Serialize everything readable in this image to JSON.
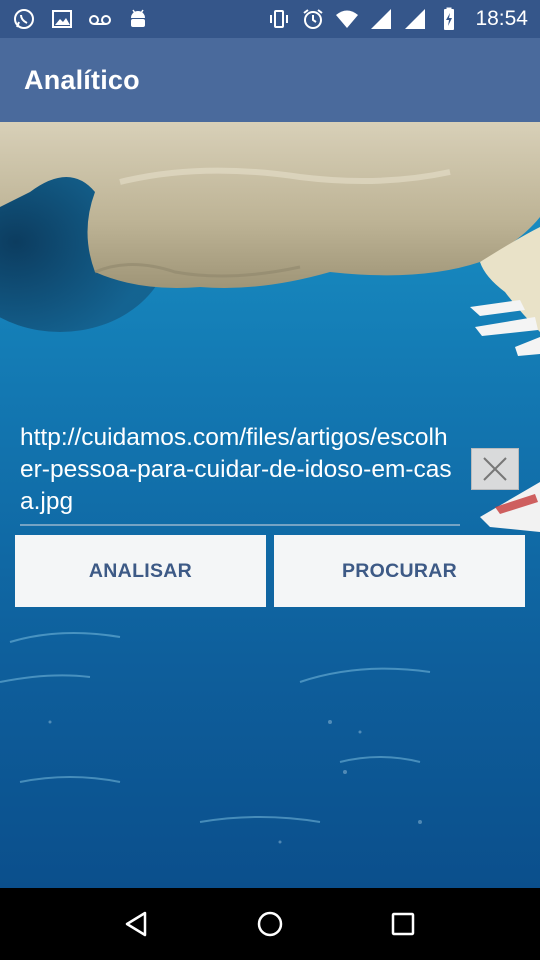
{
  "status_bar": {
    "time": "18:54",
    "icons_left": [
      "whatsapp-icon",
      "image-icon",
      "voicemail-icon",
      "android-icon"
    ],
    "icons_right": [
      "vibrate-icon",
      "alarm-icon",
      "wifi-icon",
      "signal-icon",
      "signal-icon",
      "battery-charging-icon"
    ]
  },
  "app_bar": {
    "title": "Analítico"
  },
  "url_input": {
    "value": "http://cuidamos.com/files/artigos/escolher-pessoa-para-cuidar-de-idoso-em-casa.jpg"
  },
  "buttons": {
    "analyze_label": "ANALISAR",
    "search_label": "PROCURAR"
  },
  "nav_bar": {
    "icons": [
      "back-icon",
      "home-icon",
      "recents-icon"
    ]
  },
  "colors": {
    "status_bar": "#35568a",
    "app_bar": "#4a6a9c",
    "button_text": "#3d5a86",
    "button_bg": "#f4f6f7"
  }
}
